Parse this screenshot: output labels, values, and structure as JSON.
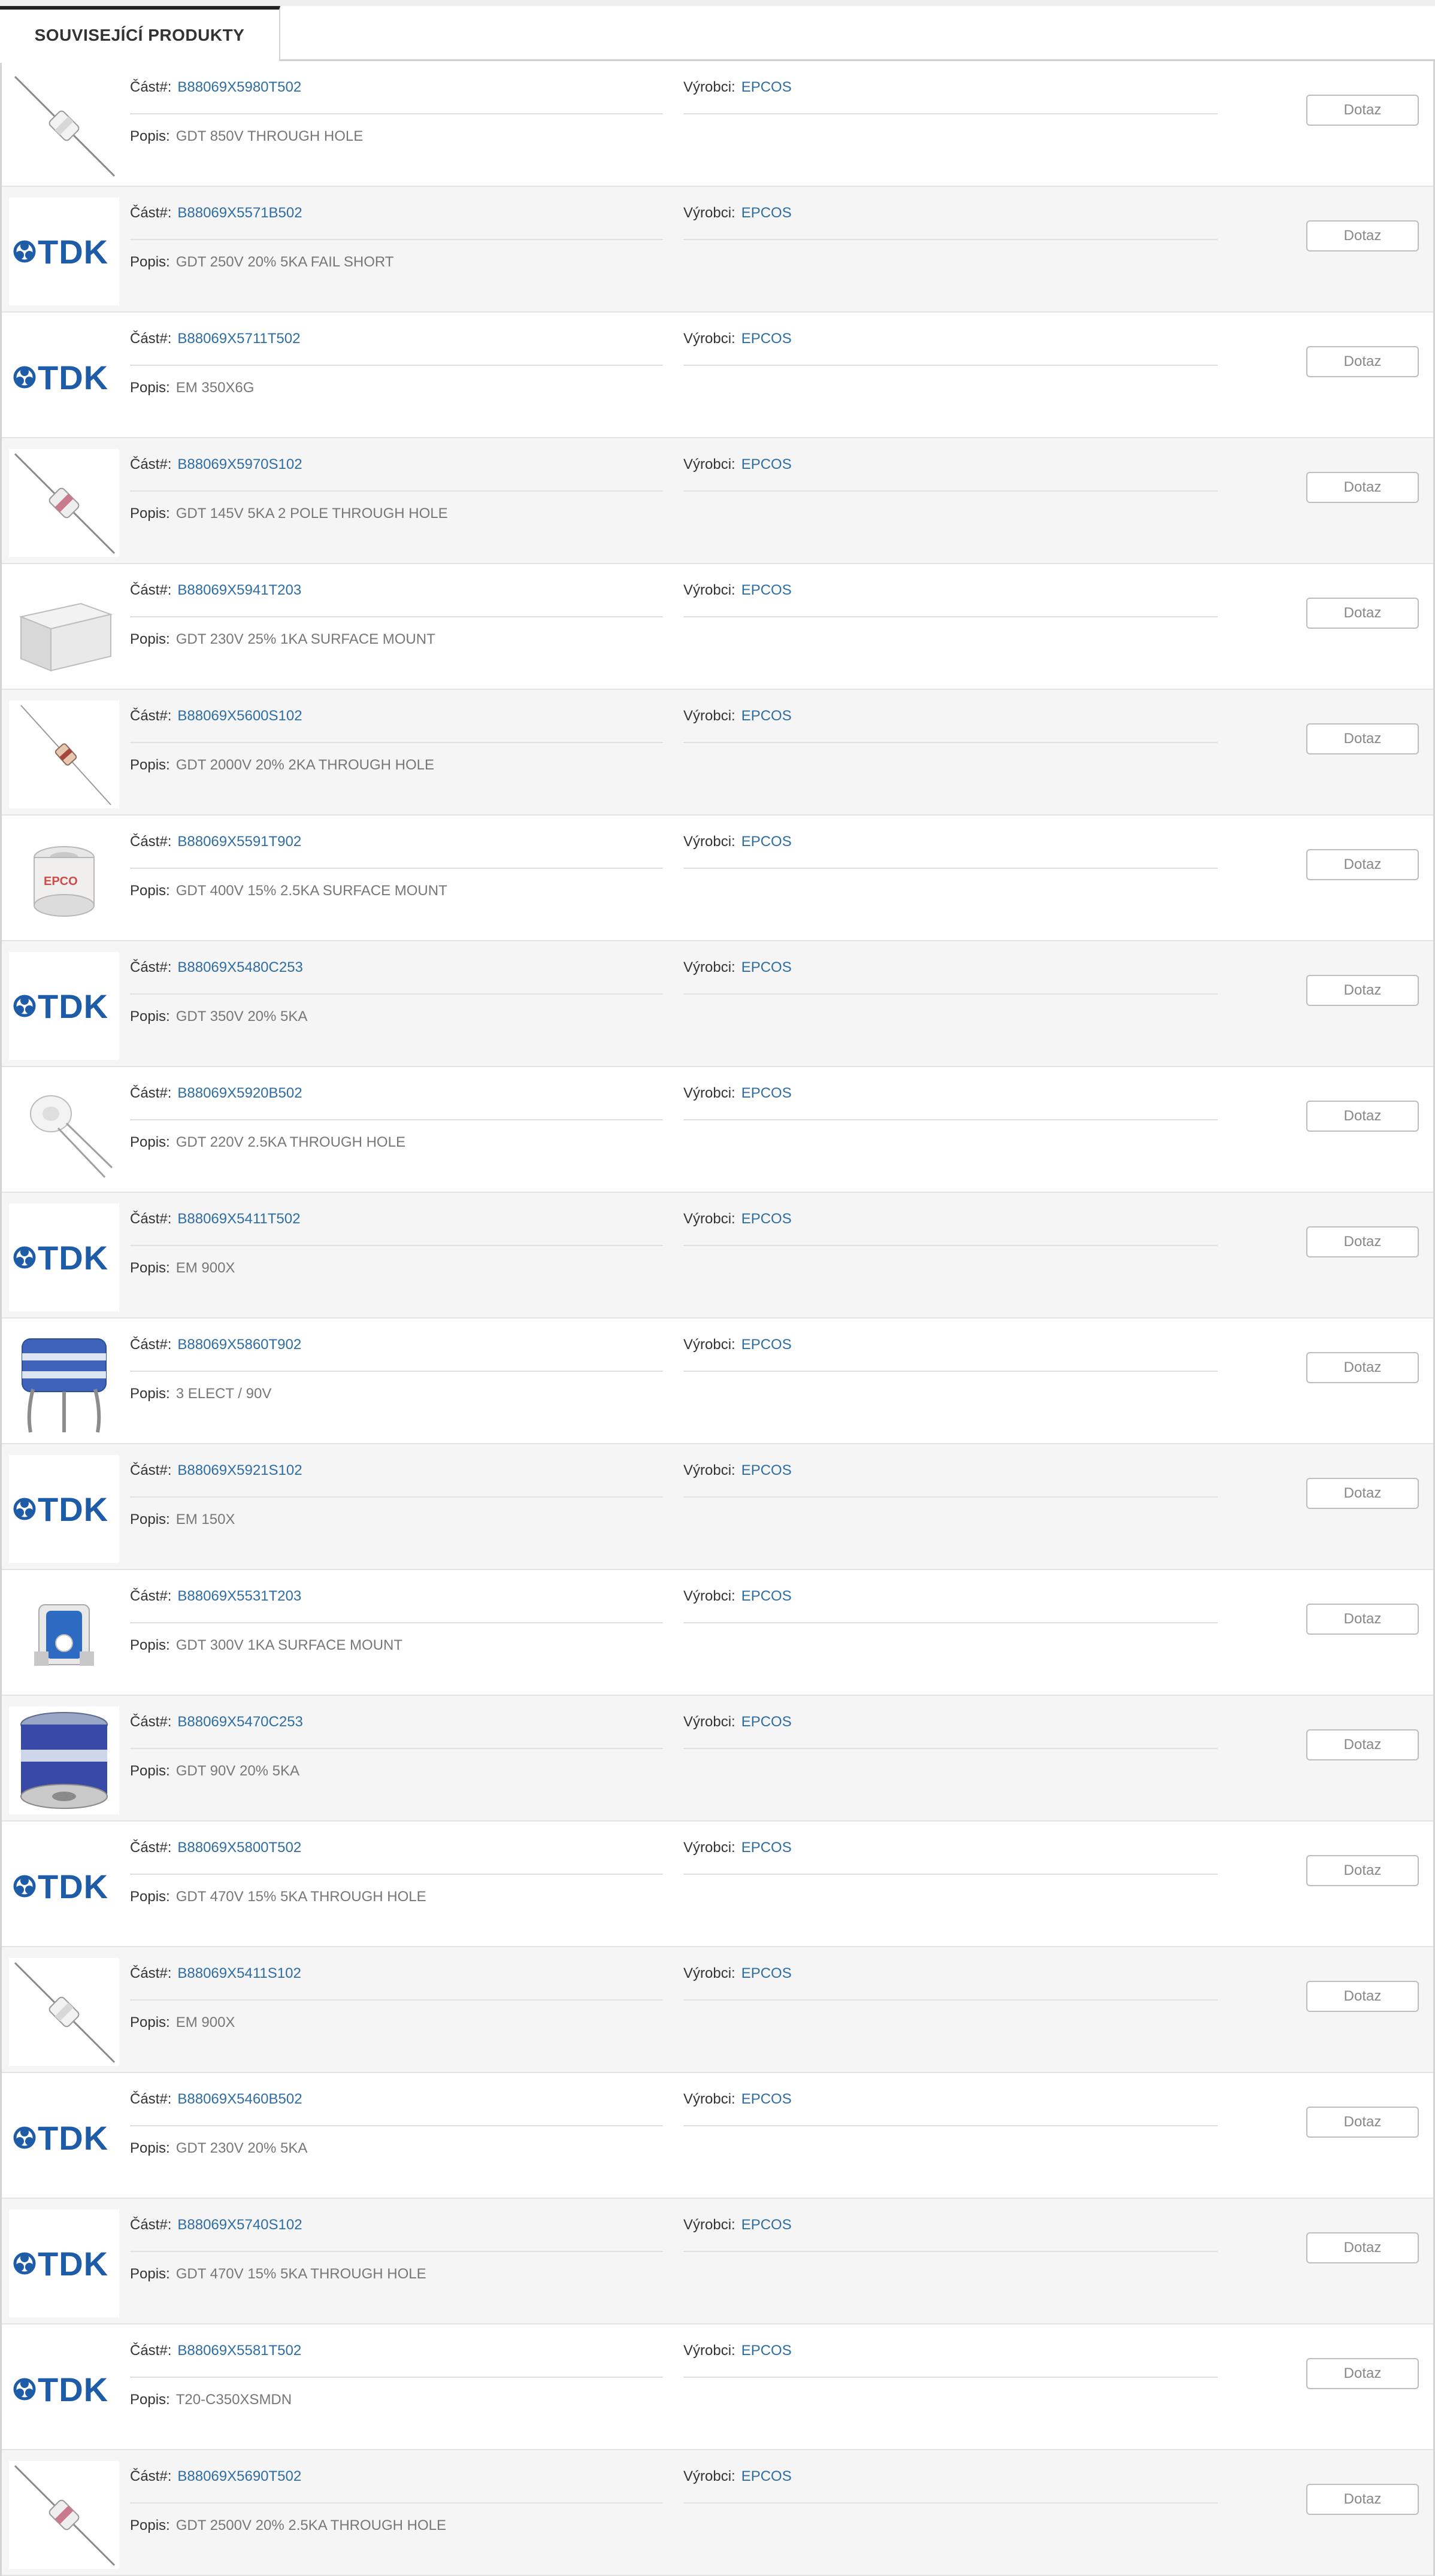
{
  "tab": {
    "label": "SOUVISEJÍCÍ PRODUKTY"
  },
  "labels": {
    "part": "Část#:",
    "manufacturer": "Výrobci:",
    "description": "Popis:",
    "button": "Dotaz"
  },
  "colors": {
    "link": "#2e6da4",
    "brand_tdk": "#1f5ca8"
  },
  "products": [
    {
      "part": "B88069X5980T502",
      "manufacturer": "EPCOS",
      "description": "GDT 850V THROUGH HOLE",
      "image": "gdt-axial-white"
    },
    {
      "part": "B88069X5571B502",
      "manufacturer": "EPCOS",
      "description": "GDT 250V 20% 5KA FAIL SHORT",
      "image": "tdk-logo"
    },
    {
      "part": "B88069X5711T502",
      "manufacturer": "EPCOS",
      "description": "EM 350X6G",
      "image": "tdk-logo"
    },
    {
      "part": "B88069X5970S102",
      "manufacturer": "EPCOS",
      "description": "GDT 145V 5KA 2 POLE THROUGH HOLE",
      "image": "gdt-axial-pink"
    },
    {
      "part": "B88069X5941T203",
      "manufacturer": "EPCOS",
      "description": "GDT 230V 25% 1KA SURFACE MOUNT",
      "image": "gdt-smd-block"
    },
    {
      "part": "B88069X5600S102",
      "manufacturer": "EPCOS",
      "description": "GDT 2000V 20% 2KA THROUGH HOLE",
      "image": "gdt-axial-red-thin"
    },
    {
      "part": "B88069X5591T902",
      "manufacturer": "EPCOS",
      "description": "GDT 400V 15% 2.5KA SURFACE MOUNT",
      "image": "gdt-smd-epcos"
    },
    {
      "part": "B88069X5480C253",
      "manufacturer": "EPCOS",
      "description": "GDT 350V 20% 5KA",
      "image": "tdk-logo"
    },
    {
      "part": "B88069X5920B502",
      "manufacturer": "EPCOS",
      "description": "GDT 220V 2.5KA THROUGH HOLE",
      "image": "gdt-radial-white"
    },
    {
      "part": "B88069X5411T502",
      "manufacturer": "EPCOS",
      "description": "EM 900X",
      "image": "tdk-logo"
    },
    {
      "part": "B88069X5860T902",
      "manufacturer": "EPCOS",
      "description": "3 ELECT / 90V",
      "image": "gdt-3pin-blue"
    },
    {
      "part": "B88069X5921S102",
      "manufacturer": "EPCOS",
      "description": "EM 150X",
      "image": "tdk-logo"
    },
    {
      "part": "B88069X5531T203",
      "manufacturer": "EPCOS",
      "description": "GDT 300V 1KA SURFACE MOUNT",
      "image": "gdt-smd-blue"
    },
    {
      "part": "B88069X5470C253",
      "manufacturer": "EPCOS",
      "description": "GDT 90V 20% 5KA",
      "image": "gdt-3elec-blue"
    },
    {
      "part": "B88069X5800T502",
      "manufacturer": "EPCOS",
      "description": "GDT 470V 15% 5KA THROUGH HOLE",
      "image": "tdk-logo"
    },
    {
      "part": "B88069X5411S102",
      "manufacturer": "EPCOS",
      "description": "EM 900X",
      "image": "gdt-axial-white"
    },
    {
      "part": "B88069X5460B502",
      "manufacturer": "EPCOS",
      "description": "GDT 230V 20% 5KA",
      "image": "tdk-logo"
    },
    {
      "part": "B88069X5740S102",
      "manufacturer": "EPCOS",
      "description": "GDT 470V 15% 5KA THROUGH HOLE",
      "image": "tdk-logo"
    },
    {
      "part": "B88069X5581T502",
      "manufacturer": "EPCOS",
      "description": "T20-C350XSMDN",
      "image": "tdk-logo"
    },
    {
      "part": "B88069X5690T502",
      "manufacturer": "EPCOS",
      "description": "GDT 2500V 20% 2.5KA THROUGH HOLE",
      "image": "gdt-axial-pink"
    }
  ]
}
